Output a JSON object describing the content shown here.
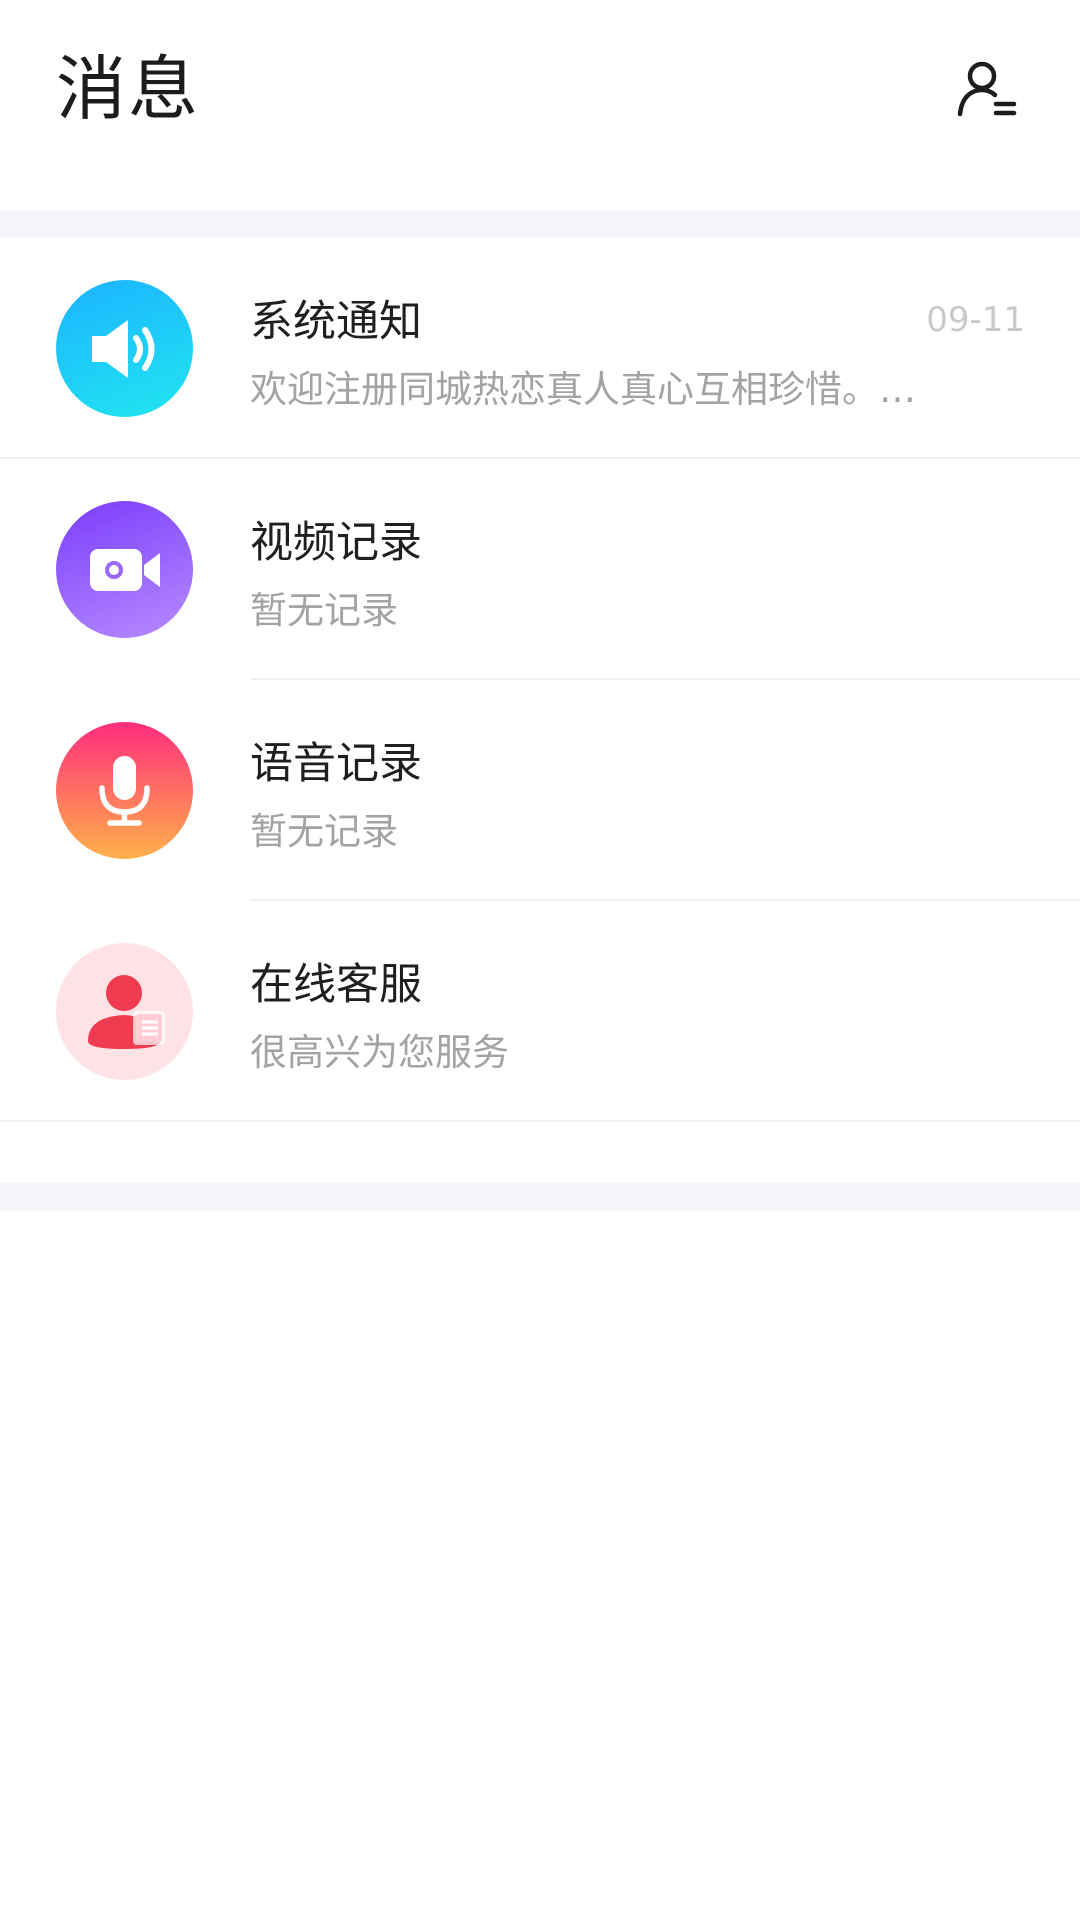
{
  "header": {
    "title": "消息",
    "contacts_icon": "person-list-icon"
  },
  "messages": [
    {
      "icon": "speaker-icon",
      "color": "#1cb3ff",
      "title": "系统通知",
      "subtitle": "欢迎注册同城热恋真人真心互相珍惜。…",
      "time": "09-11"
    },
    {
      "icon": "video-camera-icon",
      "color": "#7b3dfb",
      "title": "视频记录",
      "subtitle": "暂无记录"
    },
    {
      "icon": "microphone-icon",
      "color": "#ff2d7d",
      "title": "语音记录",
      "subtitle": "暂无记录"
    },
    {
      "icon": "customer-service-icon",
      "color": "#ef3b50",
      "title": "在线客服",
      "subtitle": "很高兴为您服务"
    }
  ]
}
